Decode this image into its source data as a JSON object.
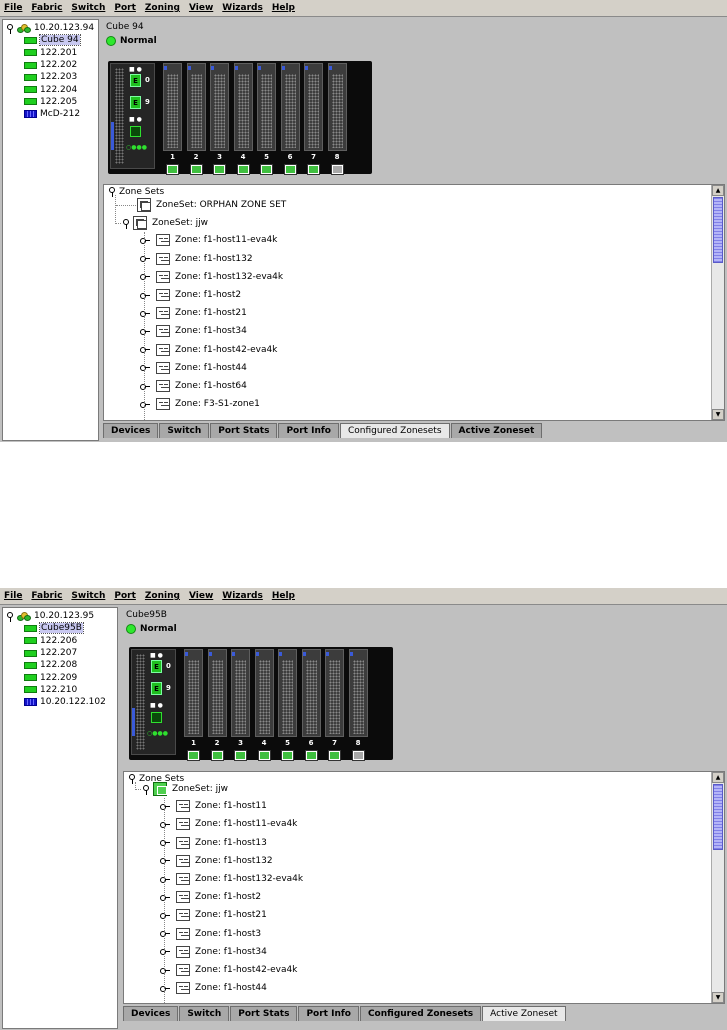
{
  "menu": [
    "File",
    "Fabric",
    "Switch",
    "Port",
    "Zoning",
    "View",
    "Wizards",
    "Help"
  ],
  "windows": [
    {
      "tree": {
        "fabric": "10.20.123.94",
        "items": [
          {
            "label": "Cube 94",
            "kind": "switch",
            "selected": true
          },
          {
            "label": "122.201",
            "kind": "switch"
          },
          {
            "label": "122.202",
            "kind": "switch"
          },
          {
            "label": "122.203",
            "kind": "switch"
          },
          {
            "label": "122.204",
            "kind": "switch"
          },
          {
            "label": "122.205",
            "kind": "switch"
          },
          {
            "label": "McD-212",
            "kind": "director"
          }
        ]
      },
      "header": {
        "title": "Cube 94",
        "status": "Normal",
        "status_color": "#2ee82e"
      },
      "chassis": {
        "sfp_ports": [
          "0",
          "9"
        ],
        "blades": [
          "1",
          "2",
          "3",
          "4",
          "5",
          "6",
          "7",
          "8"
        ],
        "port_states": [
          "on",
          "on",
          "on",
          "on",
          "on",
          "on",
          "on",
          "off"
        ]
      },
      "zones": {
        "root": "Zone Sets",
        "rows": [
          {
            "kind": "zoneset",
            "label": "ZoneSet: ORPHAN ZONE SET",
            "level": 1
          },
          {
            "kind": "zoneset",
            "label": "ZoneSet: jjw",
            "level": 1,
            "expanded": true
          },
          {
            "kind": "zone",
            "label": "Zone: f1-host11-eva4k",
            "level": 2
          },
          {
            "kind": "zone",
            "label": "Zone: f1-host132",
            "level": 2
          },
          {
            "kind": "zone",
            "label": "Zone: f1-host132-eva4k",
            "level": 2
          },
          {
            "kind": "zone",
            "label": "Zone: f1-host2",
            "level": 2
          },
          {
            "kind": "zone",
            "label": "Zone: f1-host21",
            "level": 2
          },
          {
            "kind": "zone",
            "label": "Zone: f1-host34",
            "level": 2
          },
          {
            "kind": "zone",
            "label": "Zone: f1-host42-eva4k",
            "level": 2
          },
          {
            "kind": "zone",
            "label": "Zone: f1-host44",
            "level": 2
          },
          {
            "kind": "zone",
            "label": "Zone: f1-host64",
            "level": 2
          },
          {
            "kind": "zone",
            "label": "Zone: F3-S1-zone1",
            "level": 2
          }
        ]
      },
      "tabs": [
        "Devices",
        "Switch",
        "Port Stats",
        "Port Info",
        "Configured Zonesets",
        "Active Zoneset"
      ],
      "active_tab": "Configured Zonesets"
    },
    {
      "tree": {
        "fabric": "10.20.123.95",
        "items": [
          {
            "label": "Cube95B",
            "kind": "switch",
            "selected": true
          },
          {
            "label": "122.206",
            "kind": "switch"
          },
          {
            "label": "122.207",
            "kind": "switch"
          },
          {
            "label": "122.208",
            "kind": "switch"
          },
          {
            "label": "122.209",
            "kind": "switch"
          },
          {
            "label": "122.210",
            "kind": "switch"
          },
          {
            "label": "10.20.122.102",
            "kind": "director"
          }
        ]
      },
      "header": {
        "title": "Cube95B",
        "status": "Normal",
        "status_color": "#2ee82e"
      },
      "chassis": {
        "sfp_ports": [
          "0",
          "9"
        ],
        "blades": [
          "1",
          "2",
          "3",
          "4",
          "5",
          "6",
          "7",
          "8"
        ],
        "port_states": [
          "on",
          "on",
          "on",
          "on",
          "on",
          "on",
          "on",
          "off"
        ]
      },
      "zones": {
        "root": "Zone Sets",
        "rows": [
          {
            "kind": "zoneset",
            "label": "ZoneSet: jjw",
            "level": 1,
            "expanded": true,
            "active": true
          },
          {
            "kind": "zone",
            "label": "Zone: f1-host11",
            "level": 2
          },
          {
            "kind": "zone",
            "label": "Zone: f1-host11-eva4k",
            "level": 2
          },
          {
            "kind": "zone",
            "label": "Zone: f1-host13",
            "level": 2
          },
          {
            "kind": "zone",
            "label": "Zone: f1-host132",
            "level": 2
          },
          {
            "kind": "zone",
            "label": "Zone: f1-host132-eva4k",
            "level": 2
          },
          {
            "kind": "zone",
            "label": "Zone: f1-host2",
            "level": 2
          },
          {
            "kind": "zone",
            "label": "Zone: f1-host21",
            "level": 2
          },
          {
            "kind": "zone",
            "label": "Zone: f1-host3",
            "level": 2
          },
          {
            "kind": "zone",
            "label": "Zone: f1-host34",
            "level": 2
          },
          {
            "kind": "zone",
            "label": "Zone: f1-host42-eva4k",
            "level": 2
          },
          {
            "kind": "zone",
            "label": "Zone: f1-host44",
            "level": 2
          }
        ]
      },
      "tabs": [
        "Devices",
        "Switch",
        "Port Stats",
        "Port Info",
        "Configured Zonesets",
        "Active Zoneset"
      ],
      "active_tab": "Active Zoneset"
    }
  ]
}
